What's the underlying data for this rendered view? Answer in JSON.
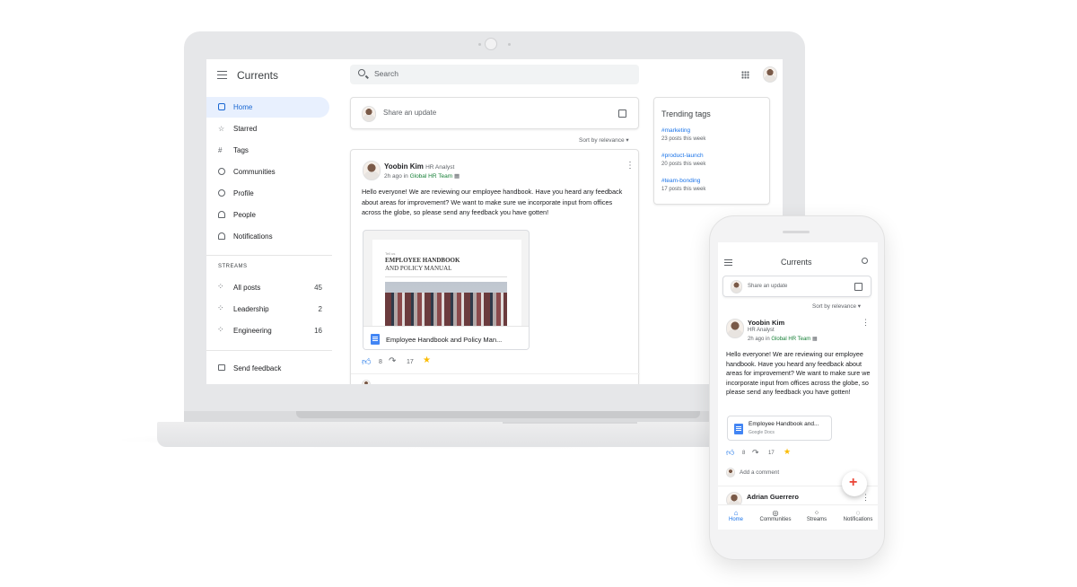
{
  "laptop": {
    "app_title": "Currents",
    "search_placeholder": "Search",
    "nav": [
      {
        "label": "Home",
        "icon": "home-icon"
      },
      {
        "label": "Starred",
        "icon": "star-icon"
      },
      {
        "label": "Tags",
        "icon": "hashtag-icon"
      },
      {
        "label": "Communities",
        "icon": "communities-icon"
      },
      {
        "label": "Profile",
        "icon": "profile-icon"
      },
      {
        "label": "People",
        "icon": "people-icon"
      },
      {
        "label": "Notifications",
        "icon": "bell-icon"
      }
    ],
    "streams_header": "STREAMS",
    "streams": [
      {
        "label": "All posts",
        "count": "45"
      },
      {
        "label": "Leadership",
        "count": "2"
      },
      {
        "label": "Engineering",
        "count": "16"
      }
    ],
    "send_feedback": "Send feedback",
    "share_placeholder": "Share an update",
    "sort_label": "Sort by relevance",
    "post": {
      "author": "Yoobin Kim",
      "role": "HR Analyst",
      "time_prefix": "2h ago in",
      "community": "Global HR Team",
      "body": "Hello everyone! We are reviewing our employee handbook. Have you heard any feedback about areas for improvement? We want to make sure we incorporate input from offices across the globe, so please send any feedback you have gotten!",
      "doc_preview_small": "Tell us",
      "doc_preview_title_1": "EMPLOYEE HANDBOOK",
      "doc_preview_title_2": "AND POLICY MANUAL",
      "attachment_title": "Employee Handbook and Policy Man...",
      "likes": "8",
      "shares": "17"
    },
    "trending": {
      "title": "Trending tags",
      "tags": [
        {
          "tag": "#marketing",
          "count": "23 posts this week"
        },
        {
          "tag": "#product-launch",
          "count": "20 posts this week"
        },
        {
          "tag": "#team-bonding",
          "count": "17 posts this week"
        }
      ]
    }
  },
  "phone": {
    "app_title": "Currents",
    "share_placeholder": "Share an update",
    "sort_label": "Sort by relevance",
    "post": {
      "author": "Yoobin Kim",
      "role": "HR Analyst",
      "time_prefix": "2h ago in",
      "community": "Global HR Team",
      "body": "Hello everyone! We are reviewing our employee handbook. Have you heard any feedback about areas for improvement? We want to make sure we incorporate input from offices across the globe, so please send any feedback you have gotten!",
      "attachment_title": "Employee Handbook and...",
      "attachment_sub": "Google Docs",
      "likes": "8",
      "shares": "17",
      "add_comment": "Add a comment"
    },
    "next_post_author": "Adrian Guerrero",
    "bottom_nav": [
      "Home",
      "Communities",
      "Streams",
      "Notifications"
    ]
  },
  "colors": {
    "accent": "#1a73e8",
    "active_bg": "#e8f0fe",
    "community_green": "#188038",
    "star": "#fbbc04"
  }
}
